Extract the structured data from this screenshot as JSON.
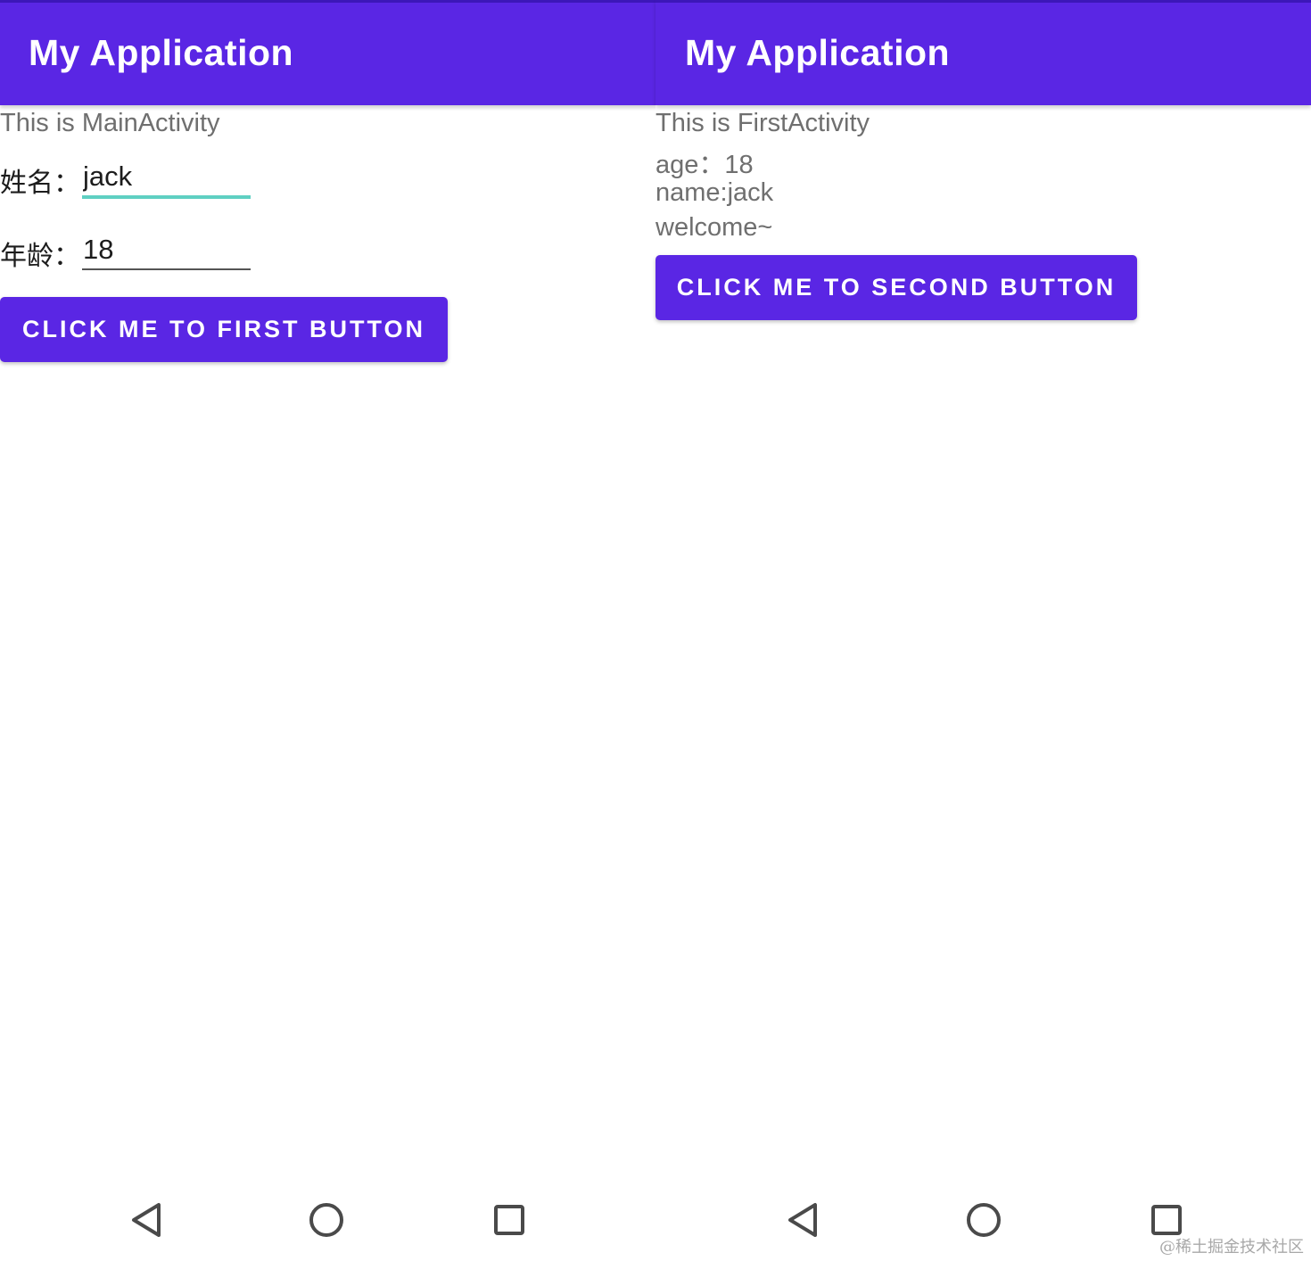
{
  "left_screen": {
    "app_title": "My Application",
    "activity_text": "This is MainActivity",
    "name_label": "姓名：",
    "name_value": "jack",
    "age_label": "年龄：",
    "age_value": "18",
    "button_label": "CLICK ME TO FIRST BUTTON"
  },
  "right_screen": {
    "app_title": "My Application",
    "lines": [
      "This is FirstActivity",
      "age：18",
      "name:jack",
      "welcome~"
    ],
    "button_label": "CLICK ME TO SECOND BUTTON"
  },
  "navigation": {
    "icons": [
      "back-icon",
      "home-icon",
      "recents-icon"
    ]
  },
  "colors": {
    "primary": "#5a26e4",
    "edit_focus": "#5fd0c2",
    "secondary_text": "#6f6f6f"
  },
  "watermark": "@稀土掘金技术社区"
}
